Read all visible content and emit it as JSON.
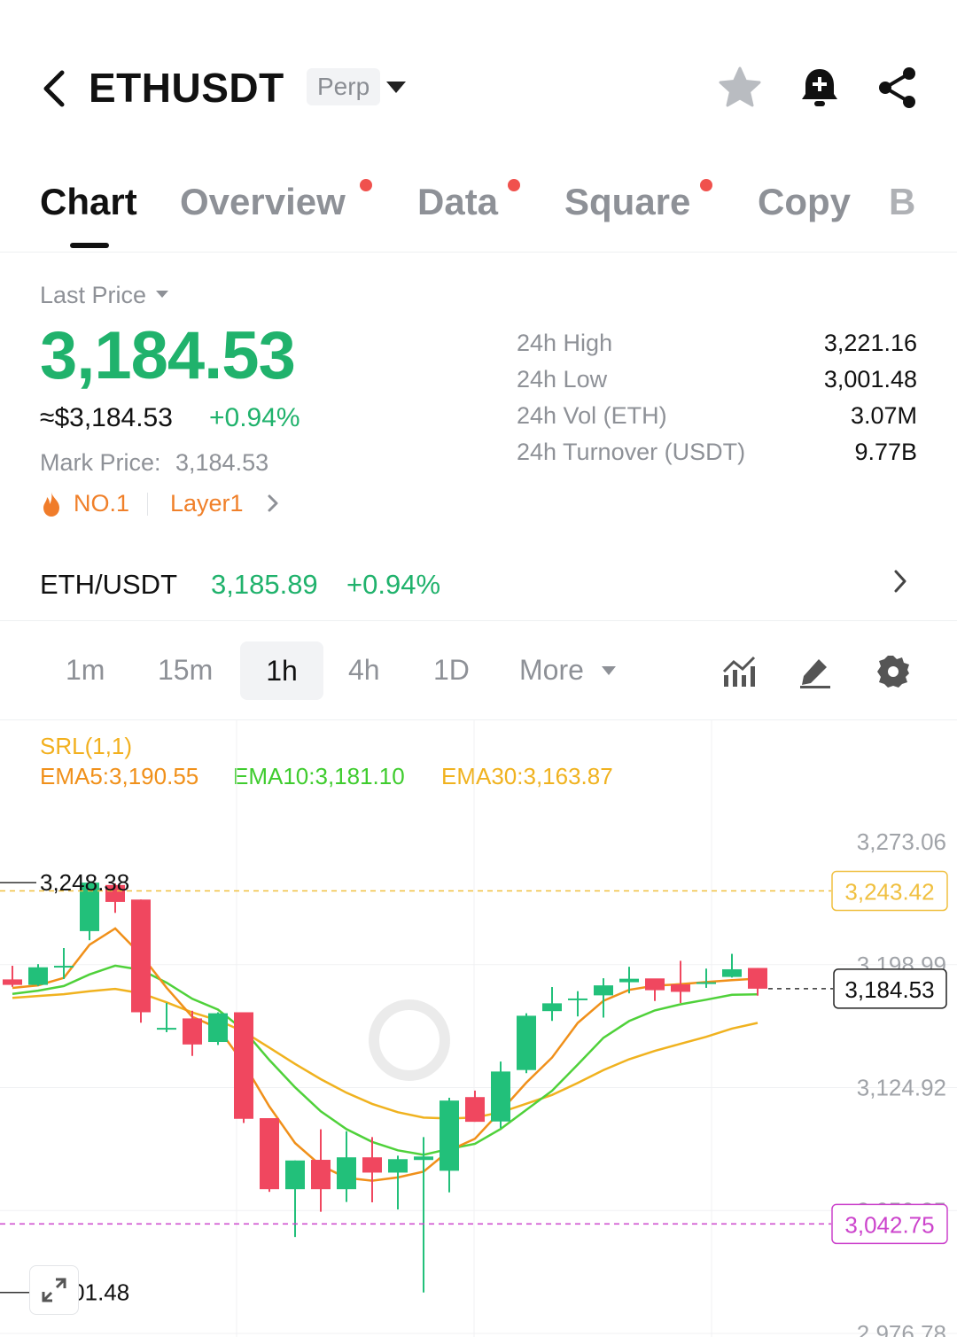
{
  "header": {
    "title": "ETHUSDT",
    "contract_type": "Perp"
  },
  "tabs": [
    {
      "label": "Chart",
      "active": true
    },
    {
      "label": "Overview",
      "dot": true
    },
    {
      "label": "Data",
      "dot": true
    },
    {
      "label": "Square",
      "dot": true
    },
    {
      "label": "Copy"
    },
    {
      "label": "B"
    }
  ],
  "price": {
    "mode_label": "Last Price",
    "last": "3,184.53",
    "usd": "≈$3,184.53",
    "change": "+0.94%",
    "mark_label": "Mark Price:",
    "mark_value": "3,184.53",
    "rank": "NO.1",
    "category": "Layer1"
  },
  "stats": {
    "high_label": "24h High",
    "high": "3,221.16",
    "low_label": "24h Low",
    "low": "3,001.48",
    "vol_label": "24h Vol (ETH)",
    "vol": "3.07M",
    "turnover_label": "24h Turnover (USDT)",
    "turnover": "9.77B"
  },
  "spot": {
    "pair": "ETH/USDT",
    "price": "3,185.89",
    "change": "+0.94%"
  },
  "timeframes": {
    "items": [
      "1m",
      "15m",
      "1h",
      "4h",
      "1D"
    ],
    "active": "1h",
    "more_label": "More"
  },
  "indicators": {
    "srl": "SRL(1,1)",
    "ema5": "EMA5:3,190.55",
    "ema10": "EMA10:3,181.10",
    "ema30": "EMA30:3,163.87"
  },
  "chart_data": {
    "type": "candlestick",
    "y_ticks": [
      "3,273.06",
      "3,198.99",
      "3,124.92",
      "3,050.85",
      "2,976.78"
    ],
    "ylim": [
      2976.78,
      3273.06
    ],
    "srl_upper": "3,243.42",
    "srl_lower": "3,042.75",
    "current": "3,184.53",
    "high_mark": "3,248.38",
    "low_mark": "3,001.48",
    "colors": {
      "up": "#22c07a",
      "down": "#f0475f",
      "ema5": "#f0901a",
      "ema10": "#4fd13a",
      "ema30": "#f0b21f",
      "srl_upper": "#f0c040",
      "srl_lower": "#cc44cc"
    },
    "candles": [
      {
        "o": 3190.1,
        "h": 3198.3,
        "l": 3185.6,
        "c": 3186.8
      },
      {
        "o": 3186.8,
        "h": 3199.3,
        "l": 3186.2,
        "c": 3197.4
      },
      {
        "o": 3198.3,
        "h": 3209.0,
        "l": 3190.3,
        "c": 3198.3
      },
      {
        "o": 3219.2,
        "h": 3248.4,
        "l": 3213.7,
        "c": 3248.4
      },
      {
        "o": 3247.0,
        "h": 3247.9,
        "l": 3230.2,
        "c": 3236.8
      },
      {
        "o": 3238.2,
        "h": 3238.2,
        "l": 3164.0,
        "c": 3170.3
      },
      {
        "o": 3160.9,
        "h": 3176.0,
        "l": 3158.3,
        "c": 3160.9
      },
      {
        "o": 3166.6,
        "h": 3171.2,
        "l": 3144.0,
        "c": 3150.9
      },
      {
        "o": 3152.4,
        "h": 3170.3,
        "l": 3150.6,
        "c": 3169.7
      },
      {
        "o": 3170.3,
        "h": 3170.3,
        "l": 3103.6,
        "c": 3106.1
      },
      {
        "o": 3106.5,
        "h": 3106.5,
        "l": 3062.1,
        "c": 3063.7
      },
      {
        "o": 3063.7,
        "h": 3081.0,
        "l": 3034.9,
        "c": 3081.0
      },
      {
        "o": 3081.4,
        "h": 3099.8,
        "l": 3050.1,
        "c": 3063.7
      },
      {
        "o": 3063.7,
        "h": 3098.6,
        "l": 3056.0,
        "c": 3082.9
      },
      {
        "o": 3082.9,
        "h": 3095.1,
        "l": 3055.8,
        "c": 3073.7
      },
      {
        "o": 3073.7,
        "h": 3083.9,
        "l": 3051.5,
        "c": 3081.8
      },
      {
        "o": 3081.3,
        "h": 3095.1,
        "l": 3001.5,
        "c": 3083.4
      },
      {
        "o": 3074.8,
        "h": 3118.8,
        "l": 3061.8,
        "c": 3117.1
      },
      {
        "o": 3119.2,
        "h": 3123.1,
        "l": 3104.3,
        "c": 3104.3
      },
      {
        "o": 3104.5,
        "h": 3140.6,
        "l": 3100.6,
        "c": 3134.6
      },
      {
        "o": 3135.5,
        "h": 3169.7,
        "l": 3133.6,
        "c": 3168.2
      },
      {
        "o": 3171.0,
        "h": 3185.5,
        "l": 3165.1,
        "c": 3175.7
      },
      {
        "o": 3178.6,
        "h": 3183.0,
        "l": 3167.8,
        "c": 3178.6
      },
      {
        "o": 3180.5,
        "h": 3190.8,
        "l": 3167.1,
        "c": 3186.5
      },
      {
        "o": 3188.4,
        "h": 3197.7,
        "l": 3181.7,
        "c": 3190.5
      },
      {
        "o": 3190.7,
        "h": 3189.7,
        "l": 3177.1,
        "c": 3183.6
      },
      {
        "o": 3187.1,
        "h": 3201.3,
        "l": 3175.9,
        "c": 3182.6
      },
      {
        "o": 3188.4,
        "h": 3196.6,
        "l": 3185.0,
        "c": 3188.4
      },
      {
        "o": 3191.6,
        "h": 3205.5,
        "l": 3191.2,
        "c": 3196.2
      },
      {
        "o": 3197.0,
        "h": 3197.0,
        "l": 3180.3,
        "c": 3184.5
      }
    ],
    "ema5": [
      3185.0,
      3186.5,
      3191.0,
      3211.0,
      3220.8,
      3205.0,
      3185.1,
      3167.5,
      3160.8,
      3139.5,
      3113.5,
      3091.5,
      3078.0,
      3070.5,
      3068.8,
      3070.8,
      3074.3,
      3087.0,
      3094.1,
      3110.7,
      3127.9,
      3143.0,
      3163.9,
      3177.2,
      3183.8,
      3186.3,
      3187.2,
      3188.5,
      3189.6,
      3190.6
    ],
    "ema10": [
      3181.4,
      3183.3,
      3186.1,
      3193.1,
      3198.4,
      3195.9,
      3188.1,
      3178.4,
      3171.9,
      3159.6,
      3141.5,
      3125.1,
      3110.6,
      3099.9,
      3092.2,
      3087.1,
      3084.4,
      3088.0,
      3091.0,
      3100.0,
      3111.5,
      3123.0,
      3138.8,
      3154.9,
      3165.0,
      3171.4,
      3175.1,
      3177.9,
      3180.8,
      3181.1
    ],
    "ema30": [
      3179.0,
      3180.1,
      3181.2,
      3183.0,
      3184.4,
      3181.8,
      3176.3,
      3170.2,
      3165.5,
      3158.6,
      3149.0,
      3139.2,
      3130.0,
      3121.8,
      3115.1,
      3110.1,
      3106.8,
      3106.3,
      3106.9,
      3110.0,
      3115.2,
      3120.5,
      3127.7,
      3135.5,
      3142.0,
      3147.0,
      3151.3,
      3155.5,
      3160.5,
      3163.9
    ]
  }
}
